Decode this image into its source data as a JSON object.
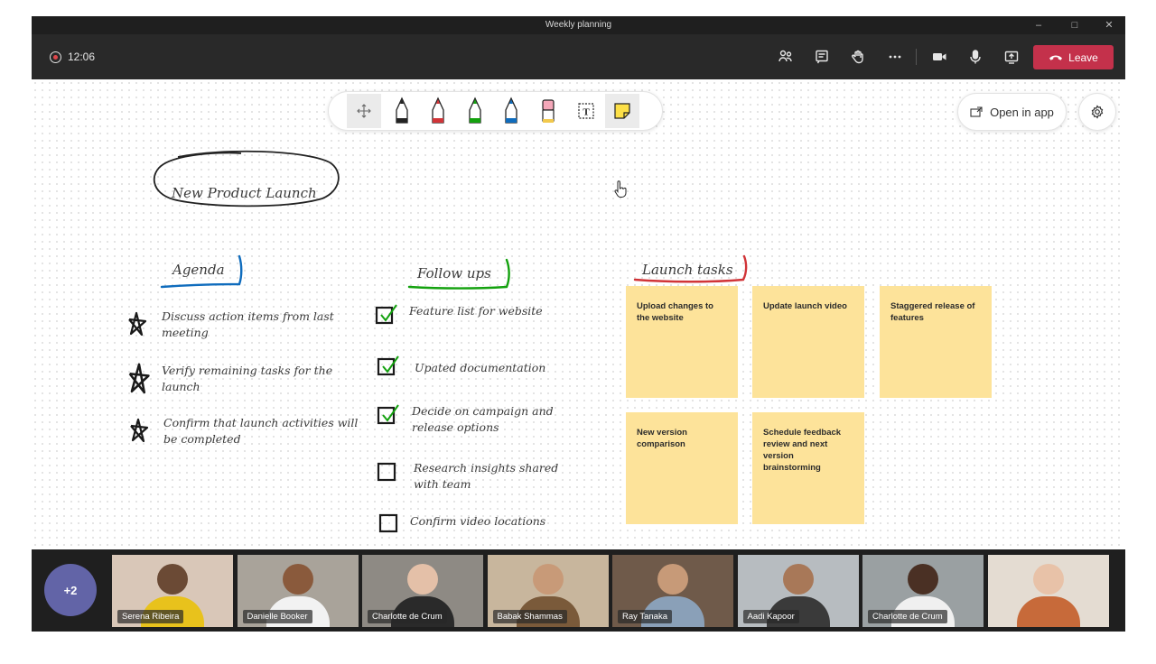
{
  "window": {
    "title": "Weekly planning",
    "minimize": "–",
    "maximize": "□",
    "close": "✕"
  },
  "meeting_bar": {
    "recording_time": "12:06",
    "buttons": [
      "people-icon",
      "chat-icon",
      "raise-hand-icon",
      "more-icon",
      "camera-icon",
      "mic-icon",
      "share-icon"
    ],
    "leave_label": "Leave",
    "leave_color": "#c4314b"
  },
  "toolbar": {
    "tools": [
      {
        "name": "move",
        "icon": "move-icon"
      },
      {
        "name": "black-pen",
        "color": "#222222"
      },
      {
        "name": "red-pen",
        "color": "#d13438"
      },
      {
        "name": "green-pen",
        "color": "#13a10e"
      },
      {
        "name": "blue-pen",
        "color": "#0f6cbd"
      },
      {
        "name": "highlighter",
        "color": "#f4a7b9"
      },
      {
        "name": "text",
        "icon": "text-icon"
      },
      {
        "name": "sticky-note",
        "icon": "sticky-note-icon",
        "color": "#fde047"
      }
    ],
    "selected_tool": "sticky-note"
  },
  "open_in_app_label": "Open in app",
  "board": {
    "title": "New Product Launch",
    "agenda": {
      "heading": "Agenda",
      "underline_color": "#0f6cbd",
      "items": [
        "Discuss action items from last meeting",
        "Verify remaining tasks for the launch",
        "Confirm that launch activities will be completed"
      ]
    },
    "follow_ups": {
      "heading": "Follow ups",
      "underline_color": "#13a10e",
      "items": [
        {
          "text": "Feature list for website",
          "checked": true
        },
        {
          "text": "Upated documentation",
          "checked": true
        },
        {
          "text": "Decide on campaign and release options",
          "checked": true
        },
        {
          "text": "Research insights shared with team",
          "checked": false
        },
        {
          "text": "Confirm video locations",
          "checked": false
        }
      ]
    },
    "launch_tasks": {
      "heading": "Launch tasks",
      "underline_color": "#d13438",
      "notes": [
        "Upload changes to the website",
        "Update launch video",
        "Staggered release of features",
        "New version comparison",
        "Schedule feedback review and next version brainstorming"
      ],
      "note_color": "#fde39a"
    }
  },
  "gallery": {
    "overflow_label": "+2",
    "participants": [
      {
        "name": "Serena Ribeira",
        "bg": "#d9c7b8",
        "skin": "#6b4a35",
        "shirt": "#e8c21c"
      },
      {
        "name": "Danielle Booker",
        "bg": "#a9a39a",
        "skin": "#8a5a3c",
        "shirt": "#f2f2f2"
      },
      {
        "name": "Charlotte de Crum",
        "bg": "#8e8a84",
        "skin": "#e4c0a8",
        "shirt": "#2a2a2a"
      },
      {
        "name": "Babak Shammas",
        "bg": "#c8b69d",
        "skin": "#c89a78",
        "shirt": "#7a5a3a"
      },
      {
        "name": "Ray Tanaka",
        "bg": "#6f5a4a",
        "skin": "#c79a78",
        "shirt": "#8aa0b8"
      },
      {
        "name": "Aadi Kapoor",
        "bg": "#b7bcc0",
        "skin": "#a87858",
        "shirt": "#3a3a3a"
      },
      {
        "name": "Charlotte de Crum",
        "bg": "#9aa0a2",
        "skin": "#4a3024",
        "shirt": "#f0f0f0"
      },
      {
        "name": "",
        "bg": "#e4dcd2",
        "skin": "#e8c2a8",
        "shirt": "#c76a3a"
      }
    ]
  }
}
